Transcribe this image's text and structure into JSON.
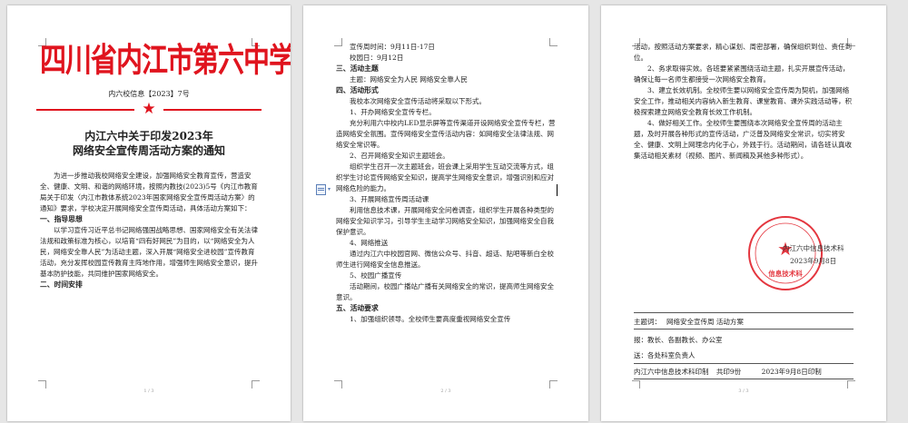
{
  "page1": {
    "title": "四川省内江市第六中学文件",
    "doc_number": "内六校信息【2023】7号",
    "notice_title_line1": "内江六中关于印发2023年",
    "notice_title_line2": "网络安全宣传周活动方案的通知",
    "intro": "为进一步推动我校网络安全建设，加强网络安全教育宣传，营造安全、健康、文明、和谐的网络环境，按照内教技(2023)5号《内江市教育局关于印发〈内江市教体系统2023年国家网络安全宣传周活动方案〉的通知》要求，学校决定开展网络安全宣传周活动，具体活动方案如下：",
    "h1": "一、指导思想",
    "p1": "以学习宣传习近平总书记网络强国战略思想、国家网络安全有关法律法规和政策标准为核心，以培育“四有好网民”为目的，以“网络安全为人民，网络安全靠人民”为活动主题，深入开展“网络安全进校园”宣传教育活动，充分发挥校园宣传教育主阵地作用，增强师生网络安全意识，提升基本防护技能，共同维护国家网络安全。",
    "h2": "二、时间安排",
    "footer": "1 / 3"
  },
  "page2": {
    "line1": "宣传周时间：9月11日-17日",
    "line2": "校园日：9月12日",
    "h3": "三、活动主题",
    "theme": "主题：网络安全为人民  网络安全靠人民",
    "h4": "四、活动形式",
    "intro": "我校本次网络安全宣传活动将采取以下形式。",
    "i1_title": "1、开办网络安全宣传专栏。",
    "i1_body": "充分利用六中校内LED显示屏等宣传渠道开设网络安全宣传专栏，营造网络安全氛围。宣传网络安全宣传活动内容：如网络安全法律法规、网络安全常识等。",
    "i2_title": "2、召开网络安全知识主题班会。",
    "i2_body": "组织学生召开一次主题班会，班会课上采用学生互动交流等方式，组织学生讨论宣传网络安全知识，提高学生网络安全意识，增强识别和应对网络危险的能力。",
    "i3_title": "3、开展网络宣传周活动课",
    "i3_body": "利用信息技术课，开展网络安全问卷调查，组织学生开展各种类型的网络安全知识学习，引导学生主动学习网络安全知识，加强网络安全自我保护意识。",
    "i4_title": "4、网络推送",
    "i4_body": "通过内江六中校园官网、微信公众号、抖音、超话、贴吧等新白全校师生进行网络安全信息推送。",
    "i5_title": "5、校园广播宣传",
    "i5_body": "活动期间，校园广播站广播有关网络安全的常识，提高师生网络安全意识。",
    "h5": "五、活动要求",
    "req1": "1、加强组织领导。全校师生要高度重视网络安全宣传",
    "footer": "2 / 3"
  },
  "page3": {
    "req1_cont": "活动，按照活动方案要求，精心谋划、周密部署，确保组织到位、责任到位。",
    "req2": "2、务求取得实效。各班要紧紧围绕活动主题，扎实开展宣传活动，确保让每一名师生都接受一次网络安全教育。",
    "req3": "3、建立长效机制。全校师生要以网络安全宣传周为契机，加强网络安全工作，推动相关内容纳入新生教育、课堂教育、课外实践活动等，积极探索建立网络安全教育长效工作机制。",
    "req4": "4、做好相关工作。全校师生要围绕本次网络安全宣传周的活动主题，及时开展各种形式的宣传活动，广泛普及网络安全常识，切实将安全、健康、文明上网理念内化于心，外践于行。活动期间，请各班认真收集活动相关素材（视频、图片、新闻稿及其他多种形式）。",
    "seal_bottom": "信息技术科",
    "sign_unit": "内江六中信息技术科",
    "sign_date": "2023年9月8日",
    "subject_label": "主题词：",
    "subject_value": "网络安全宣传周  活动方案",
    "cc_label": "报：",
    "cc_value": "教长、各副教长、办公室",
    "send_label": "送：",
    "send_value": "各处科室负责人",
    "print_unit": "内江六中信息技术科印制",
    "print_count": "共印9份",
    "print_date": "2023年9月8日印制",
    "footer": "3 / 3"
  },
  "colors": {
    "red": "#e0141e",
    "page_bg": "#ffffff",
    "desk": "#e6e6e6"
  }
}
